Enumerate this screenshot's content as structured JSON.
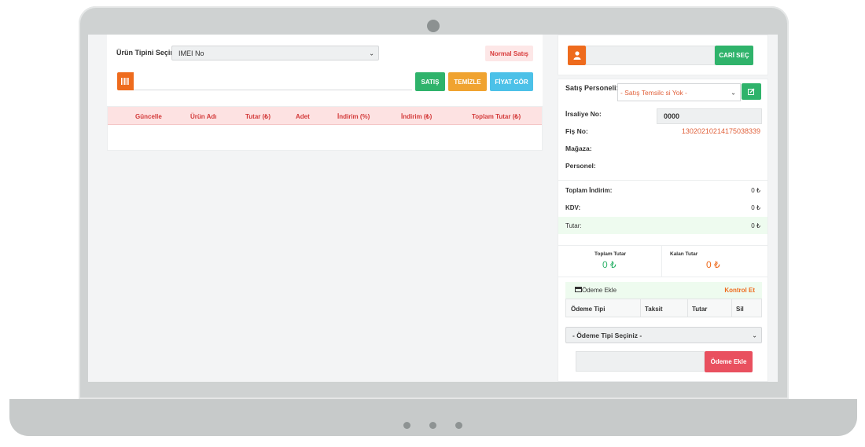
{
  "left": {
    "product_type_label": "Ürün Tipini Seçiniz",
    "product_type_value": "IMEI No",
    "sale_mode": "Normal Satış",
    "barcode_icon": "barcode-icon",
    "buttons": {
      "sale": "SATIŞ",
      "clear": "TEMİZLE",
      "price": "FİYAT GÖR"
    },
    "table_headers": [
      "Güncelle",
      "Ürün Adı",
      "Tutar (₺)",
      "Adet",
      "İndirim (%)",
      "İndirim (₺)",
      "Toplam Tutar (₺)"
    ]
  },
  "right": {
    "customer_icon": "user-icon",
    "select_customer": "CARİ SEÇ",
    "sales_staff_label": "Satış Personeli:",
    "sales_staff_value": "- Satış Temsilc si Yok -",
    "edit_icon": "edit-icon",
    "waybill_label": "İrsaliye No:",
    "waybill_value": "0000",
    "receipt_label": "Fiş No:",
    "receipt_value": "13020210214175038339",
    "store_label": "Mağaza:",
    "staff_label": "Personel:",
    "totals": [
      {
        "label": "Toplam İndirim:",
        "value": "0 ₺"
      },
      {
        "label": "KDV:",
        "value": "0 ₺"
      },
      {
        "label": "Tutar:",
        "value": "0 ₺"
      }
    ],
    "total_amount_label": "Toplam Tutar",
    "total_amount_value": "0 ₺",
    "remaining_label": "Kalan Tutar",
    "remaining_value": "0 ₺",
    "payment_title": "Ödeme Ekle",
    "payment_icon": "card-icon",
    "check": "Kontrol Et",
    "payment_headers": [
      "Ödeme Tipi",
      "Taksit",
      "Tutar",
      "Sil"
    ],
    "payment_type_placeholder": "- Ödeme Tipi Seçiniz -",
    "add_payment": "Ödeme Ekle"
  },
  "colors": {
    "green": "#2fb36b",
    "orange": "#f0a330",
    "blue": "#4cc1e8",
    "red": "#e9505f",
    "accent": "#ee6b1d"
  }
}
